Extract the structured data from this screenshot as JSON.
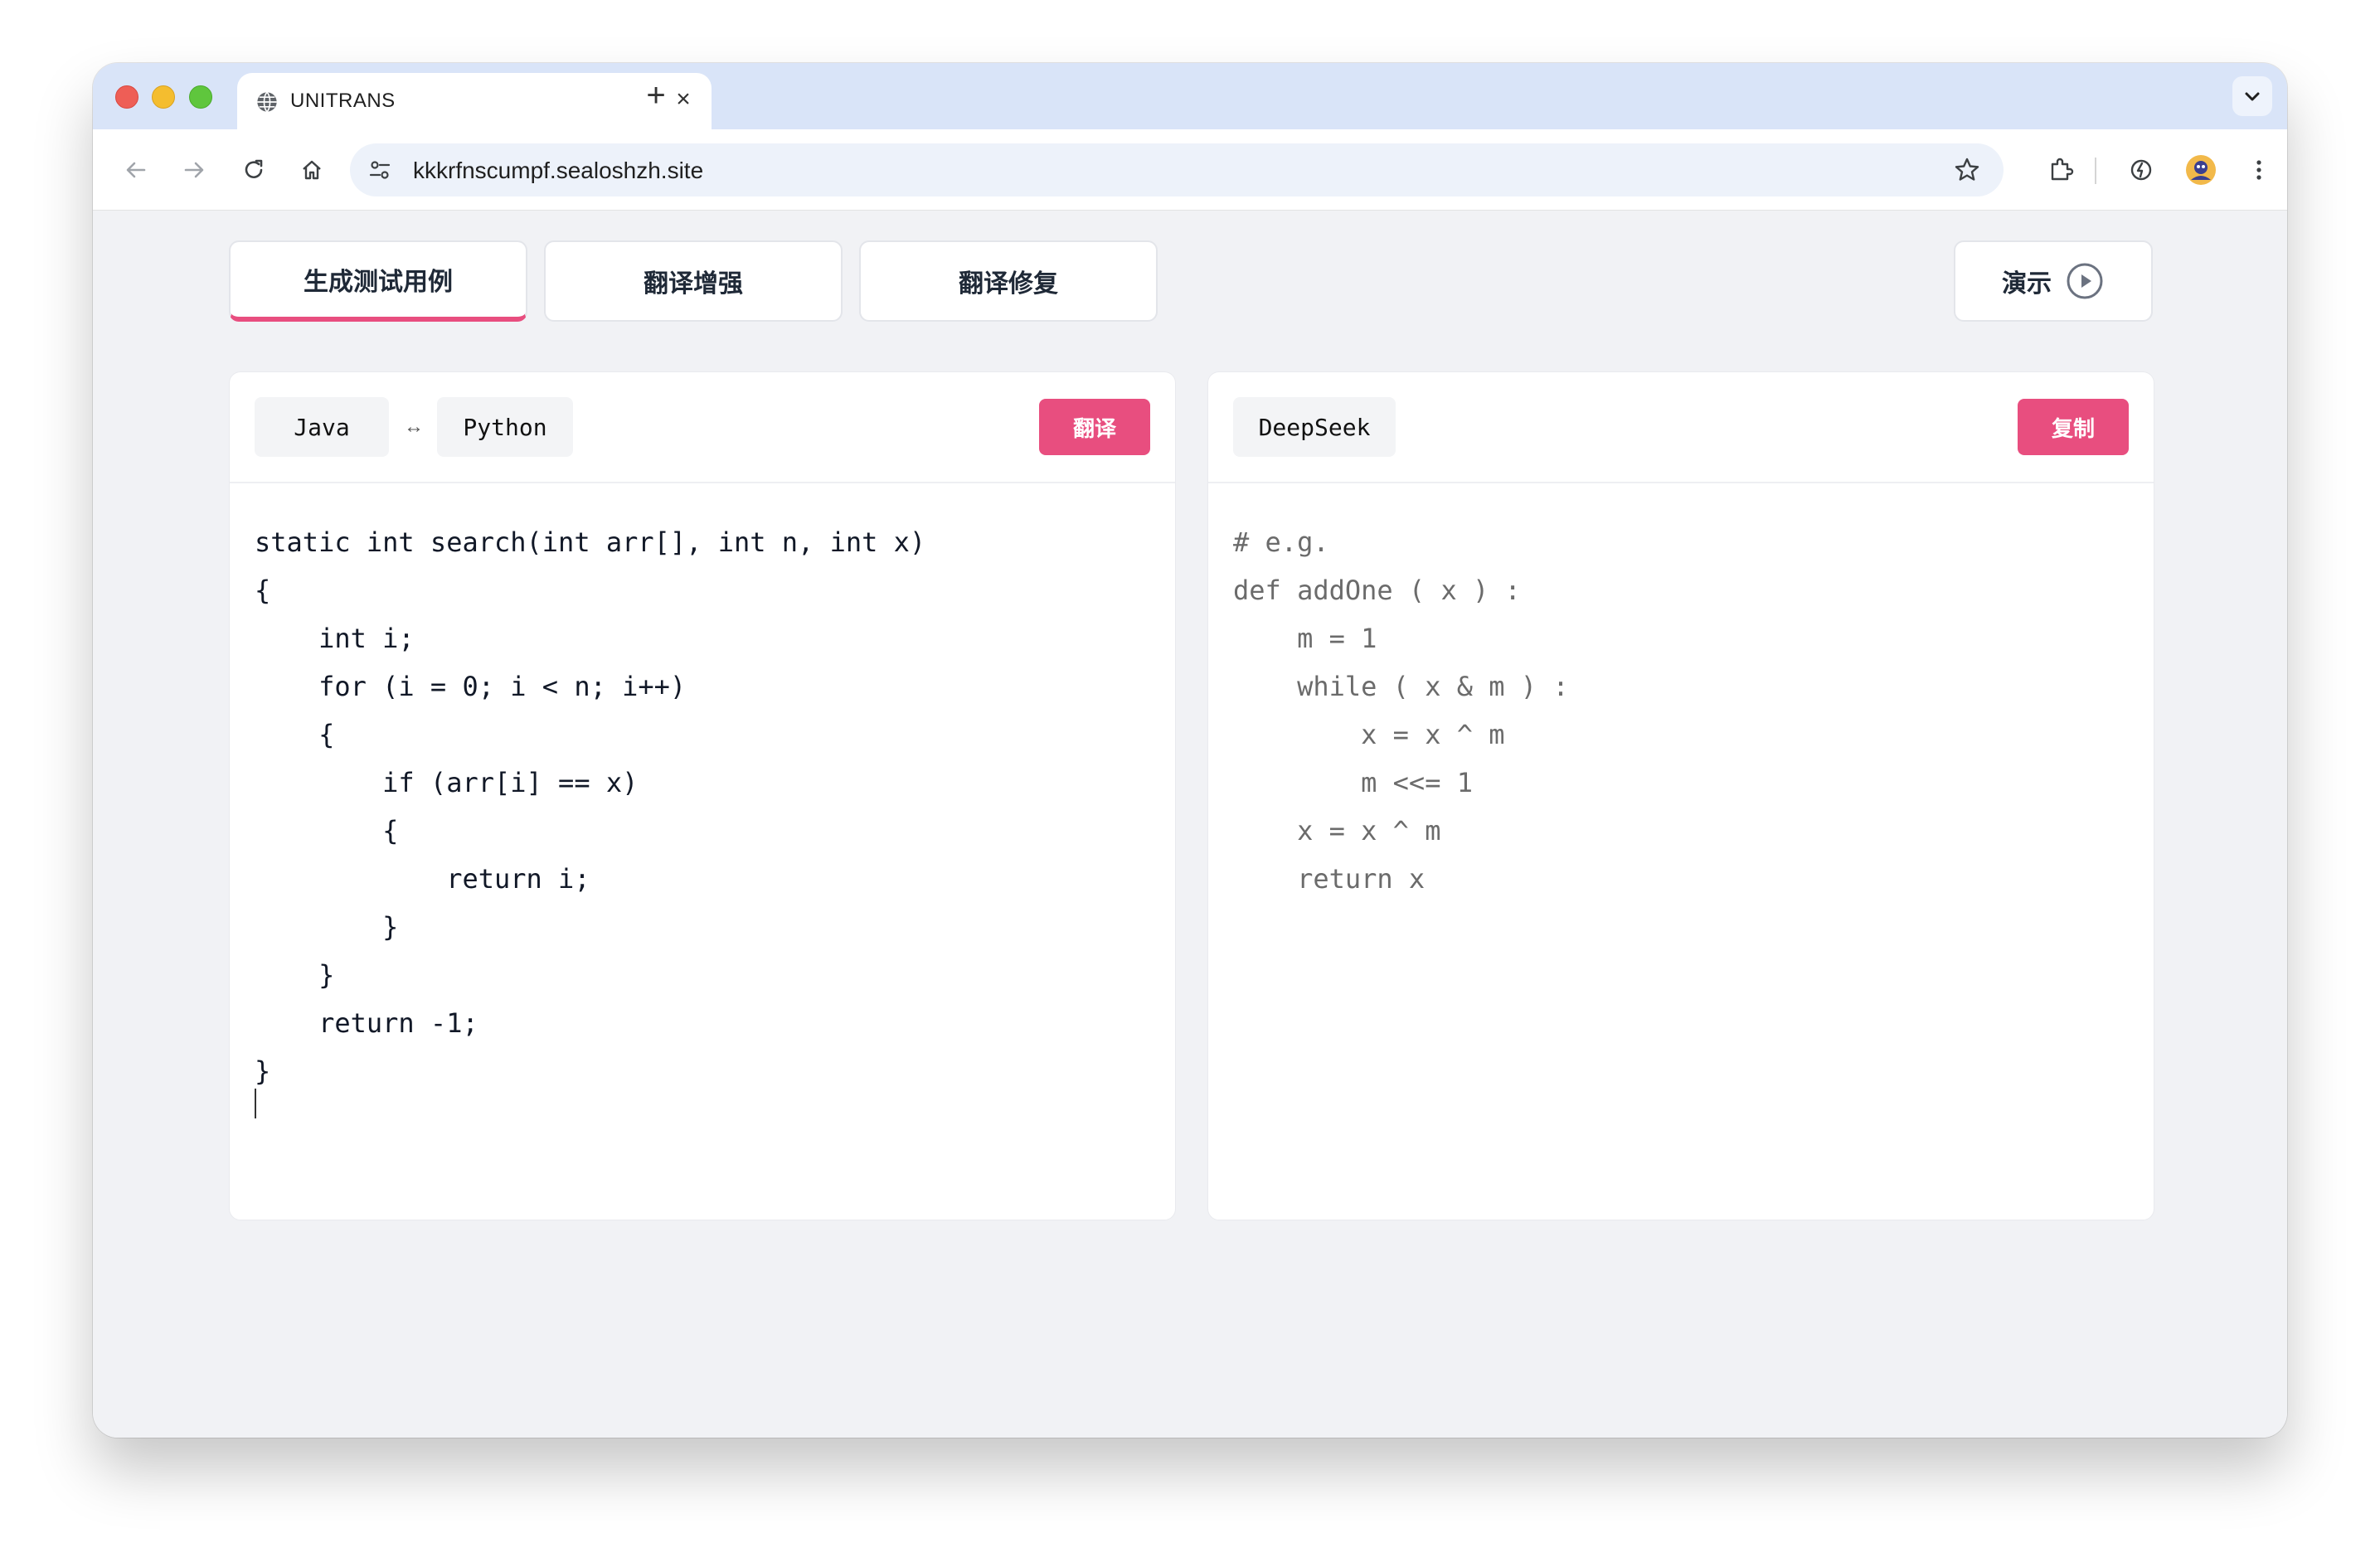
{
  "browser": {
    "tab_title": "UNITRANS",
    "url": "kkkrfnscumpf.sealoshzh.site"
  },
  "mode_tabs": [
    {
      "label": "生成测试用例",
      "active": true
    },
    {
      "label": "翻译增强",
      "active": false
    },
    {
      "label": "翻译修复",
      "active": false
    }
  ],
  "demo_button": {
    "label": "演示"
  },
  "source_panel": {
    "source_lang": "Java",
    "swap_symbol": "↔",
    "target_lang": "Python",
    "action_label": "翻译",
    "code": "static int search(int arr[], int n, int x)\n{\n    int i;\n    for (i = 0; i < n; i++)\n    {\n        if (arr[i] == x)\n        {\n            return i;\n        }\n    }\n    return -1;\n}"
  },
  "output_panel": {
    "model": "DeepSeek",
    "action_label": "复制",
    "placeholder_code": "# e.g.\ndef addOne ( x ) :\n    m = 1\n    while ( x & m ) :\n        x = x ^ m\n        m <<= 1\n    x = x ^ m\n    return x"
  },
  "colors": {
    "accent": "#e84e7f",
    "tabstrip": "#d9e4f8",
    "page_bg": "#f1f2f5"
  }
}
